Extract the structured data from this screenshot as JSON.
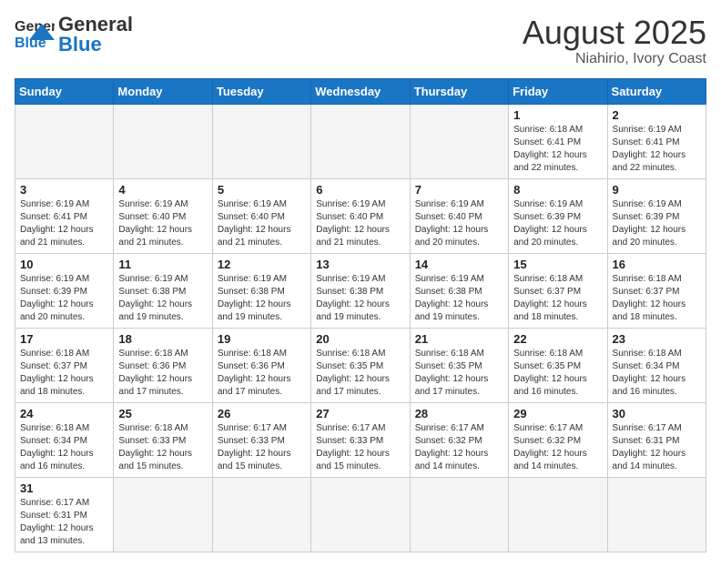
{
  "header": {
    "logo_general": "General",
    "logo_blue": "Blue",
    "month_year": "August 2025",
    "location": "Niahirio, Ivory Coast"
  },
  "weekdays": [
    "Sunday",
    "Monday",
    "Tuesday",
    "Wednesday",
    "Thursday",
    "Friday",
    "Saturday"
  ],
  "weeks": [
    [
      {
        "day": "",
        "info": ""
      },
      {
        "day": "",
        "info": ""
      },
      {
        "day": "",
        "info": ""
      },
      {
        "day": "",
        "info": ""
      },
      {
        "day": "",
        "info": ""
      },
      {
        "day": "1",
        "info": "Sunrise: 6:18 AM\nSunset: 6:41 PM\nDaylight: 12 hours and 22 minutes."
      },
      {
        "day": "2",
        "info": "Sunrise: 6:19 AM\nSunset: 6:41 PM\nDaylight: 12 hours and 22 minutes."
      }
    ],
    [
      {
        "day": "3",
        "info": "Sunrise: 6:19 AM\nSunset: 6:41 PM\nDaylight: 12 hours and 21 minutes."
      },
      {
        "day": "4",
        "info": "Sunrise: 6:19 AM\nSunset: 6:40 PM\nDaylight: 12 hours and 21 minutes."
      },
      {
        "day": "5",
        "info": "Sunrise: 6:19 AM\nSunset: 6:40 PM\nDaylight: 12 hours and 21 minutes."
      },
      {
        "day": "6",
        "info": "Sunrise: 6:19 AM\nSunset: 6:40 PM\nDaylight: 12 hours and 21 minutes."
      },
      {
        "day": "7",
        "info": "Sunrise: 6:19 AM\nSunset: 6:40 PM\nDaylight: 12 hours and 20 minutes."
      },
      {
        "day": "8",
        "info": "Sunrise: 6:19 AM\nSunset: 6:39 PM\nDaylight: 12 hours and 20 minutes."
      },
      {
        "day": "9",
        "info": "Sunrise: 6:19 AM\nSunset: 6:39 PM\nDaylight: 12 hours and 20 minutes."
      }
    ],
    [
      {
        "day": "10",
        "info": "Sunrise: 6:19 AM\nSunset: 6:39 PM\nDaylight: 12 hours and 20 minutes."
      },
      {
        "day": "11",
        "info": "Sunrise: 6:19 AM\nSunset: 6:38 PM\nDaylight: 12 hours and 19 minutes."
      },
      {
        "day": "12",
        "info": "Sunrise: 6:19 AM\nSunset: 6:38 PM\nDaylight: 12 hours and 19 minutes."
      },
      {
        "day": "13",
        "info": "Sunrise: 6:19 AM\nSunset: 6:38 PM\nDaylight: 12 hours and 19 minutes."
      },
      {
        "day": "14",
        "info": "Sunrise: 6:19 AM\nSunset: 6:38 PM\nDaylight: 12 hours and 19 minutes."
      },
      {
        "day": "15",
        "info": "Sunrise: 6:18 AM\nSunset: 6:37 PM\nDaylight: 12 hours and 18 minutes."
      },
      {
        "day": "16",
        "info": "Sunrise: 6:18 AM\nSunset: 6:37 PM\nDaylight: 12 hours and 18 minutes."
      }
    ],
    [
      {
        "day": "17",
        "info": "Sunrise: 6:18 AM\nSunset: 6:37 PM\nDaylight: 12 hours and 18 minutes."
      },
      {
        "day": "18",
        "info": "Sunrise: 6:18 AM\nSunset: 6:36 PM\nDaylight: 12 hours and 17 minutes."
      },
      {
        "day": "19",
        "info": "Sunrise: 6:18 AM\nSunset: 6:36 PM\nDaylight: 12 hours and 17 minutes."
      },
      {
        "day": "20",
        "info": "Sunrise: 6:18 AM\nSunset: 6:35 PM\nDaylight: 12 hours and 17 minutes."
      },
      {
        "day": "21",
        "info": "Sunrise: 6:18 AM\nSunset: 6:35 PM\nDaylight: 12 hours and 17 minutes."
      },
      {
        "day": "22",
        "info": "Sunrise: 6:18 AM\nSunset: 6:35 PM\nDaylight: 12 hours and 16 minutes."
      },
      {
        "day": "23",
        "info": "Sunrise: 6:18 AM\nSunset: 6:34 PM\nDaylight: 12 hours and 16 minutes."
      }
    ],
    [
      {
        "day": "24",
        "info": "Sunrise: 6:18 AM\nSunset: 6:34 PM\nDaylight: 12 hours and 16 minutes."
      },
      {
        "day": "25",
        "info": "Sunrise: 6:18 AM\nSunset: 6:33 PM\nDaylight: 12 hours and 15 minutes."
      },
      {
        "day": "26",
        "info": "Sunrise: 6:17 AM\nSunset: 6:33 PM\nDaylight: 12 hours and 15 minutes."
      },
      {
        "day": "27",
        "info": "Sunrise: 6:17 AM\nSunset: 6:33 PM\nDaylight: 12 hours and 15 minutes."
      },
      {
        "day": "28",
        "info": "Sunrise: 6:17 AM\nSunset: 6:32 PM\nDaylight: 12 hours and 14 minutes."
      },
      {
        "day": "29",
        "info": "Sunrise: 6:17 AM\nSunset: 6:32 PM\nDaylight: 12 hours and 14 minutes."
      },
      {
        "day": "30",
        "info": "Sunrise: 6:17 AM\nSunset: 6:31 PM\nDaylight: 12 hours and 14 minutes."
      }
    ],
    [
      {
        "day": "31",
        "info": "Sunrise: 6:17 AM\nSunset: 6:31 PM\nDaylight: 12 hours and 13 minutes."
      },
      {
        "day": "",
        "info": ""
      },
      {
        "day": "",
        "info": ""
      },
      {
        "day": "",
        "info": ""
      },
      {
        "day": "",
        "info": ""
      },
      {
        "day": "",
        "info": ""
      },
      {
        "day": "",
        "info": ""
      }
    ]
  ]
}
